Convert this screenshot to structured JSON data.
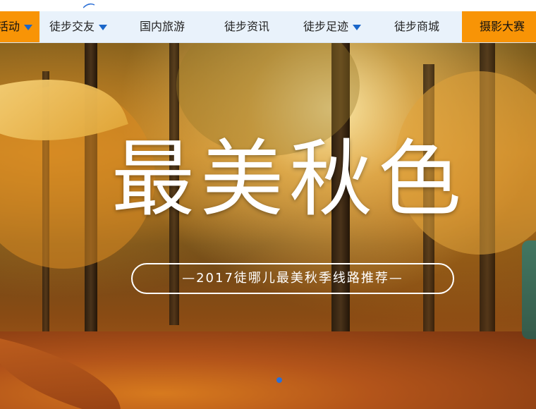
{
  "nav": {
    "items": [
      {
        "label": "活动",
        "has_dropdown": true,
        "highlight": true
      },
      {
        "label": "徒步交友",
        "has_dropdown": true,
        "highlight": false
      },
      {
        "label": "国内旅游",
        "has_dropdown": false,
        "highlight": false
      },
      {
        "label": "徒步资讯",
        "has_dropdown": false,
        "highlight": false
      },
      {
        "label": "徒步足迹",
        "has_dropdown": true,
        "highlight": false
      },
      {
        "label": "徒步商城",
        "has_dropdown": false,
        "highlight": false
      },
      {
        "label": "摄影大赛",
        "has_dropdown": false,
        "highlight": true
      }
    ],
    "colors": {
      "bar": "#e9f2fb",
      "highlight": "#f89406",
      "caret": "#1a66c9"
    }
  },
  "banner": {
    "title": "最美秋色",
    "subtitle": "—2017徒哪儿最美秋季线路推荐—",
    "slide_indicator_active": 1,
    "colors": {
      "dot": "#2b6fd6"
    }
  }
}
